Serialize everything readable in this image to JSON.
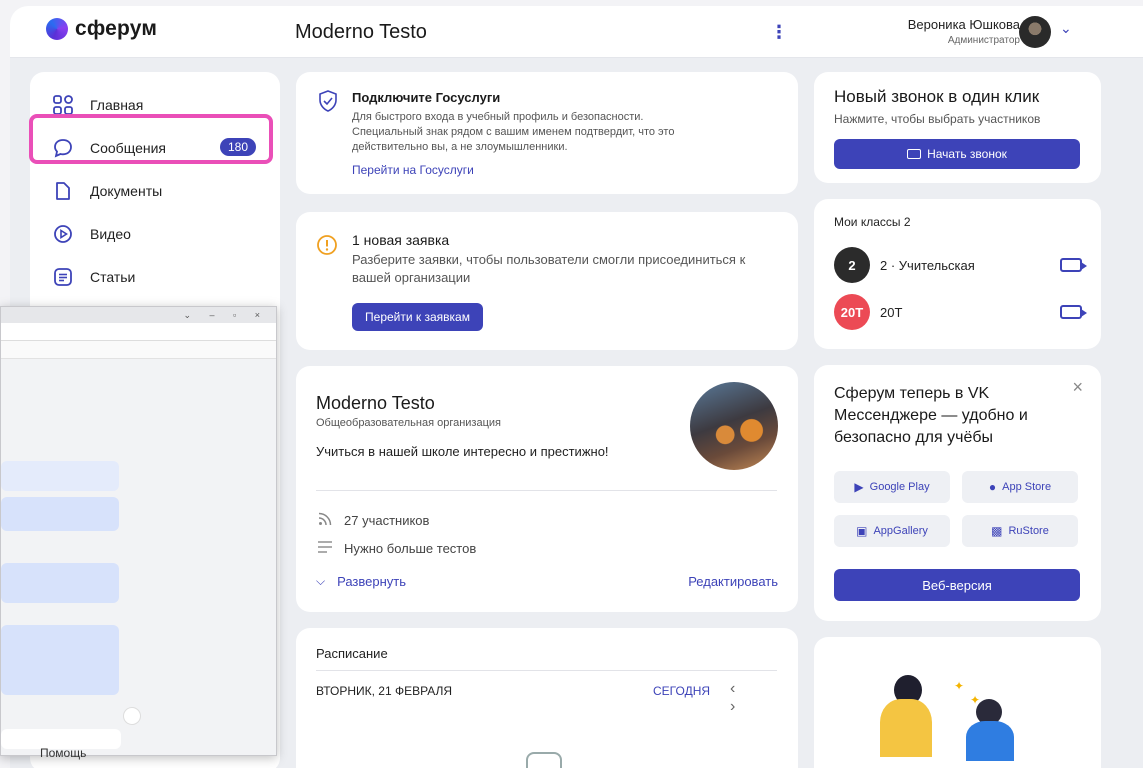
{
  "header": {
    "logo_text": "сферум",
    "org_title": "Moderno Testo",
    "kebab": "⋮",
    "user_name": "Вероника Юшкова",
    "user_role": "Администратор"
  },
  "sidebar": {
    "items": [
      {
        "label": "Главная",
        "icon": "home-grid-icon"
      },
      {
        "label": "Сообщения",
        "icon": "chat-bubble-icon",
        "badge": "180"
      },
      {
        "label": "Документы",
        "icon": "document-icon"
      },
      {
        "label": "Видео",
        "icon": "play-circle-icon"
      },
      {
        "label": "Статьи",
        "icon": "article-icon"
      }
    ],
    "footer_peek": "Помощь"
  },
  "gosuslugi": {
    "title": "Подключите Госуслуги",
    "text": "Для быстрого входа в учебный профиль и безопасности. Специальный знак рядом с вашим именем подтвердит, что это действительно вы, а не злоумышленники.",
    "link": "Перейти на Госуслуги"
  },
  "requests": {
    "title": "1 новая заявка",
    "text": "Разберите заявки, чтобы пользователи смогли присоединиться к вашей организации",
    "button": "Перейти к заявкам"
  },
  "organization": {
    "name": "Moderno Testo",
    "type": "Общеобразовательная организация",
    "description": "Учиться в нашей школе интересно и престижно!",
    "members": "27 участников",
    "note": "Нужно больше тестов",
    "expand": "Развернуть",
    "edit": "Редактировать"
  },
  "schedule": {
    "title": "Расписание",
    "date": "ВТОРНИК, 21 ФЕВРАЛЯ",
    "today": "СЕГОДНЯ",
    "arrows": "‹ ›"
  },
  "call": {
    "title": "Новый звонок в один клик",
    "subtitle": "Нажмите, чтобы выбрать участников",
    "button": "Начать звонок"
  },
  "classes": {
    "title": "Мои классы 2",
    "items": [
      {
        "avatar": "2",
        "name": "2 · Учительская",
        "color": "#2b2b2b"
      },
      {
        "avatar": "20T",
        "name": "20T",
        "color": "#ec4a55"
      }
    ]
  },
  "promo": {
    "text": "Сферум теперь в VK Мессенджере — удобно и безопасно для учёбы",
    "close": "×",
    "stores": [
      {
        "label": "Google Play",
        "icon": "google-play-icon"
      },
      {
        "label": "App Store",
        "icon": "apple-icon"
      },
      {
        "label": "AppGallery",
        "icon": "appgallery-icon"
      },
      {
        "label": "RuStore",
        "icon": "rustore-icon"
      }
    ],
    "web_button": "Веб-версия"
  },
  "colors": {
    "accent": "#3d43b8",
    "highlight": "#ea4fb8",
    "class_dark": "#2b2b2b",
    "class_red": "#ec4a55"
  }
}
